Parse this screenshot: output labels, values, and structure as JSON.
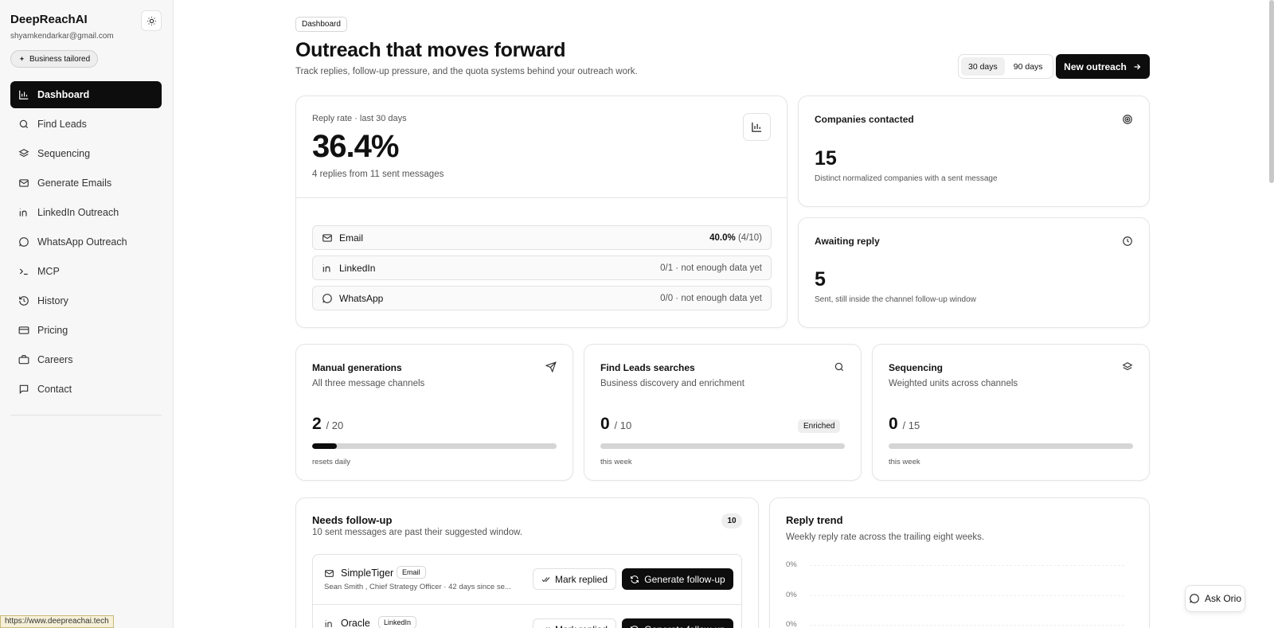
{
  "app": {
    "brand": "DeepReachAI",
    "user_email": "shyamkendarkar@gmail.com",
    "plan_badge": "Business tailored"
  },
  "sidebar": {
    "items": [
      {
        "label": "Dashboard",
        "icon": "bar-chart-icon",
        "active": true
      },
      {
        "label": "Find Leads",
        "icon": "search-icon"
      },
      {
        "label": "Sequencing",
        "icon": "layers-icon"
      },
      {
        "label": "Generate Emails",
        "icon": "mail-plus-icon"
      },
      {
        "label": "LinkedIn Outreach",
        "icon": "linkedin-icon"
      },
      {
        "label": "WhatsApp Outreach",
        "icon": "message-circle-icon"
      },
      {
        "label": "MCP",
        "icon": "terminal-icon"
      },
      {
        "label": "History",
        "icon": "history-icon"
      },
      {
        "label": "Pricing",
        "icon": "credit-card-icon"
      },
      {
        "label": "Careers",
        "icon": "briefcase-icon"
      },
      {
        "label": "Contact",
        "icon": "message-square-icon"
      }
    ]
  },
  "status_url": "https://www.deepreachai.tech",
  "header": {
    "breadcrumb": "Dashboard",
    "title": "Outreach that moves forward",
    "subtitle": "Track replies, follow-up pressure, and the quota systems behind your outreach work.",
    "range_30": "30 days",
    "range_90": "90 days",
    "new_outreach": "New outreach"
  },
  "reply_rate": {
    "label": "Reply rate · last 30 days",
    "value": "36.4%",
    "note": "4 replies from 11 sent messages",
    "channels": [
      {
        "name": "Email",
        "strong": "40.0%",
        "rest": " (4/10)"
      },
      {
        "name": "LinkedIn",
        "strong": "",
        "rest": "0/1 · not enough data yet"
      },
      {
        "name": "WhatsApp",
        "strong": "",
        "rest": "0/0 · not enough data yet"
      }
    ]
  },
  "companies": {
    "label": "Companies contacted",
    "value": "15",
    "desc": "Distinct normalized companies with a sent message"
  },
  "awaiting": {
    "label": "Awaiting reply",
    "value": "5",
    "desc": "Sent, still inside the channel follow-up window"
  },
  "quotas": [
    {
      "title": "Manual generations",
      "desc": "All three message channels",
      "used": "2",
      "limit": "/ 20",
      "fraction": 0.1,
      "foot": "resets daily",
      "badge": ""
    },
    {
      "title": "Find Leads searches",
      "desc": "Business discovery and enrichment",
      "used": "0",
      "limit": "/ 10",
      "fraction": 0,
      "foot": "this week",
      "badge": "Enriched"
    },
    {
      "title": "Sequencing",
      "desc": "Weighted units across channels",
      "used": "0",
      "limit": "/ 15",
      "fraction": 0,
      "foot": "this week",
      "badge": ""
    }
  ],
  "followup": {
    "title": "Needs follow-up",
    "subtitle": "10 sent messages are past their suggested window.",
    "count": "10",
    "mark_label": "Mark replied",
    "gen_label": "Generate follow-up",
    "rows": [
      {
        "company": "SimpleTiger",
        "channel": "Email",
        "meta": "Sean Smith , Chief Strategy Officer · 42 days since se..."
      },
      {
        "company": "Oracle",
        "channel": "LinkedIn",
        "meta": ""
      }
    ]
  },
  "trend": {
    "title": "Reply trend",
    "subtitle": "Weekly reply rate across the trailing eight weeks.",
    "ticks": [
      "0%",
      "0%",
      "0%"
    ]
  },
  "ask": {
    "label": "Ask Orio"
  },
  "colors": {
    "accent": "#0d0d0d",
    "bar_track": "#d5d5d5",
    "sidebar_bg": "#f7f7f7"
  }
}
